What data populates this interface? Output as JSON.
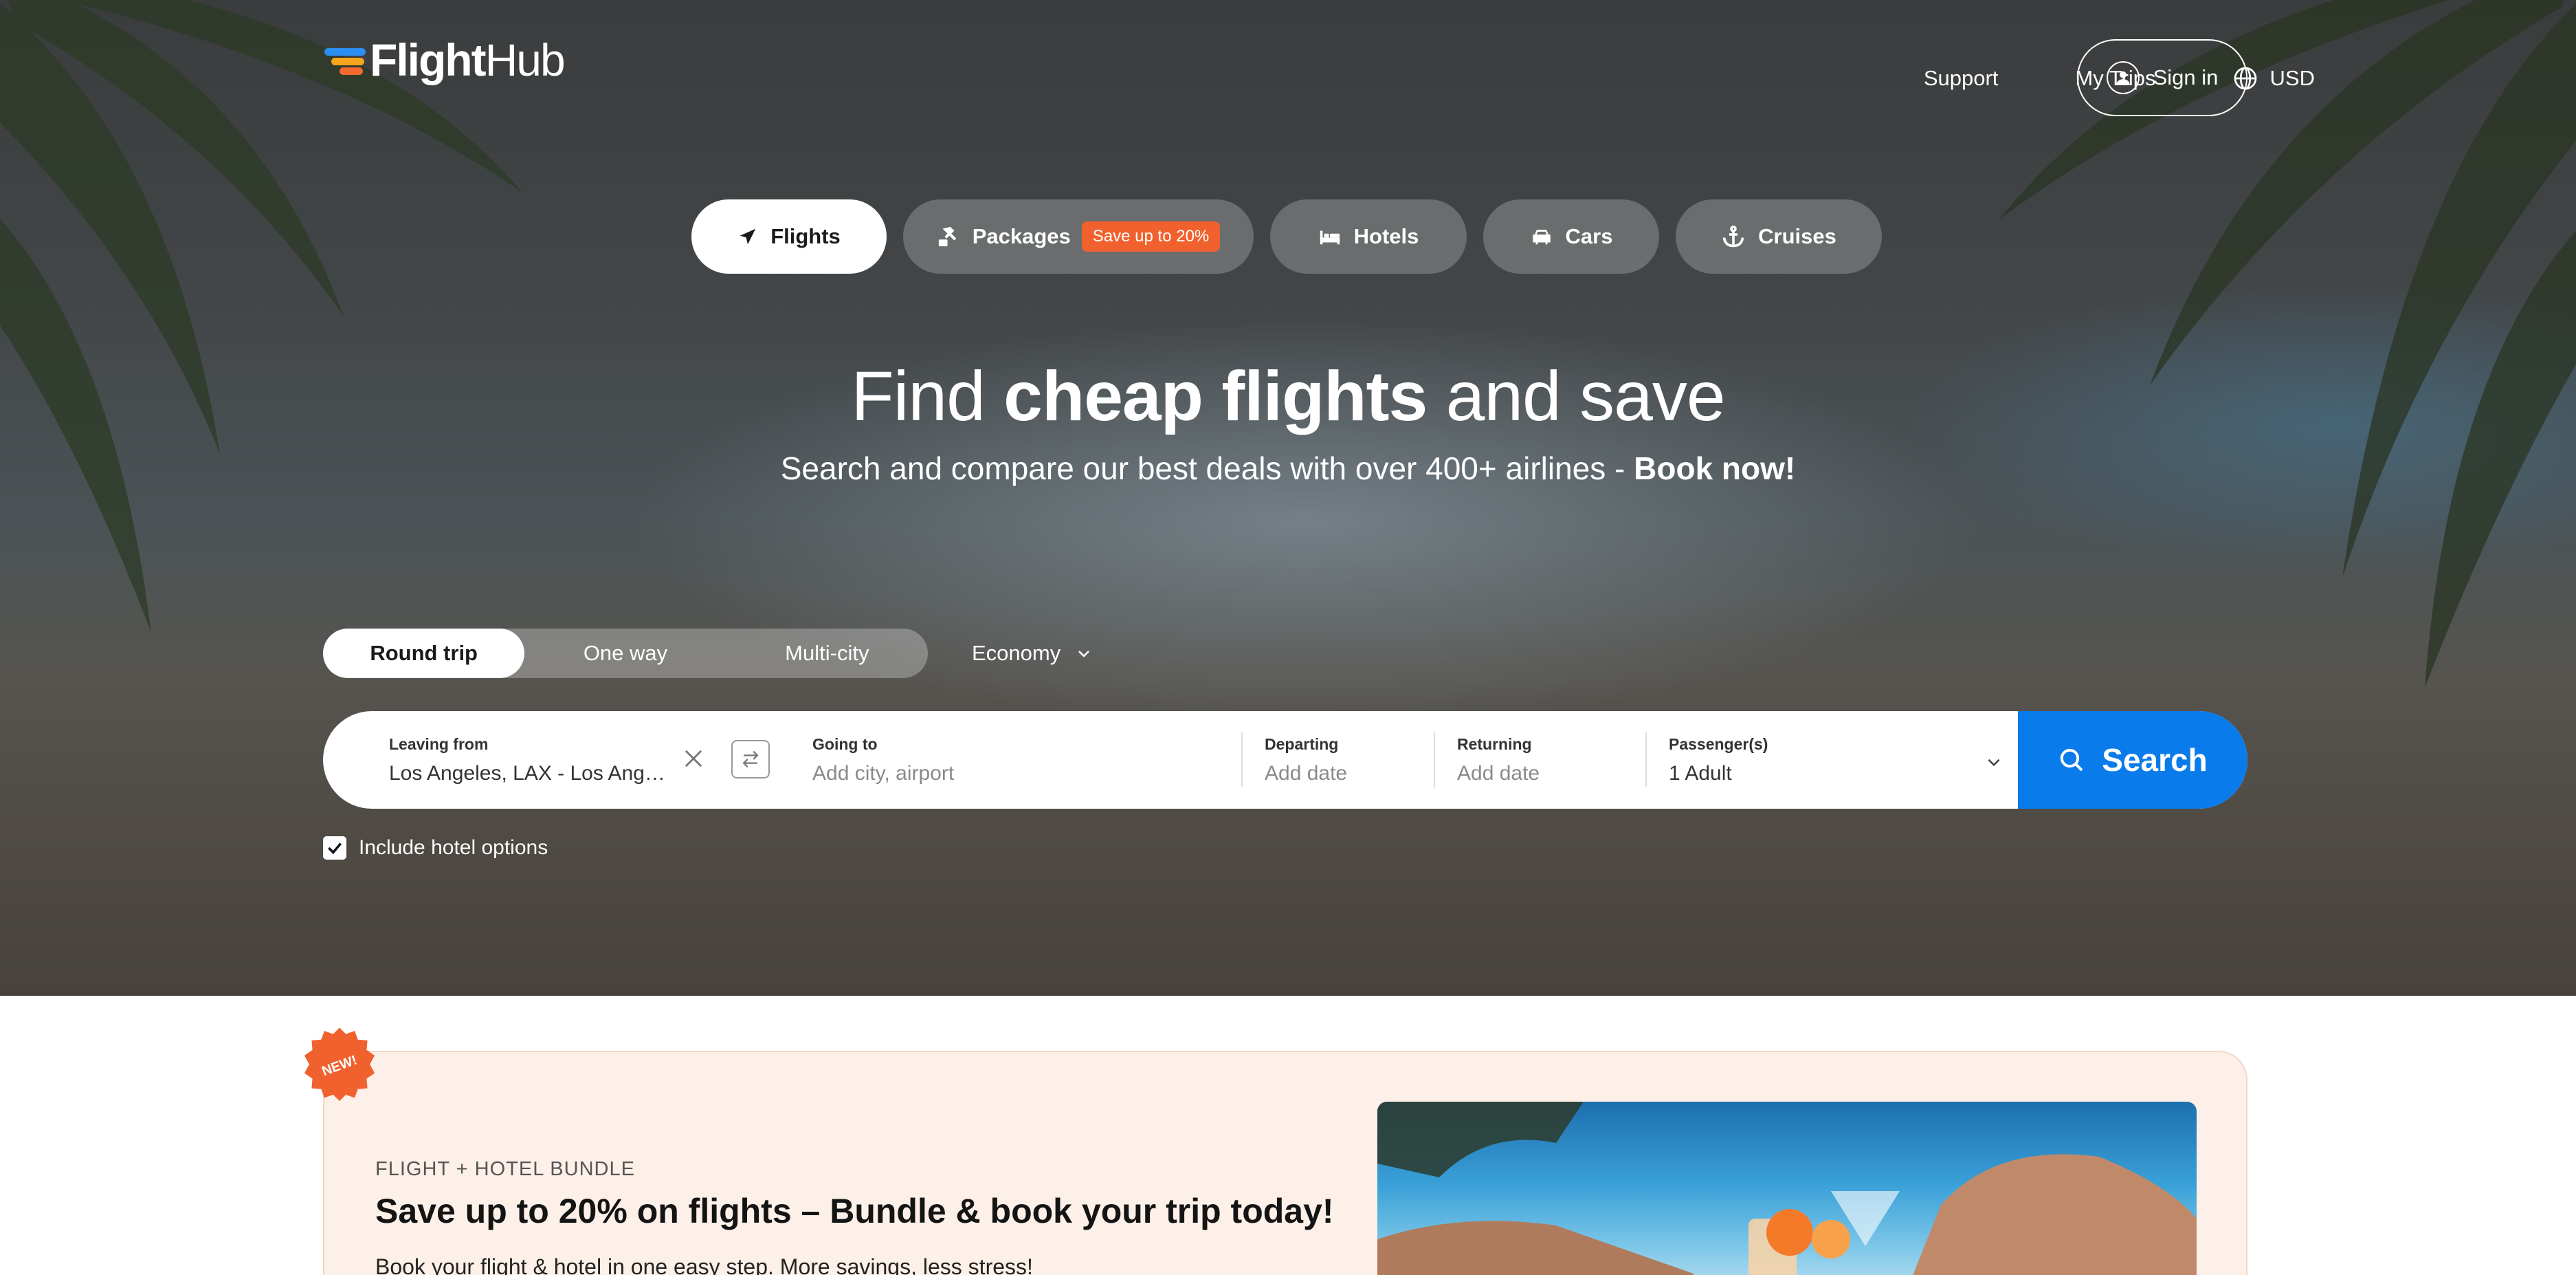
{
  "brand": {
    "name_bold": "Flight",
    "name_light": "Hub"
  },
  "topnav": {
    "support": "Support",
    "my_trips": "My Trips",
    "currency": "USD",
    "sign_in": "Sign in"
  },
  "product_tabs": [
    {
      "label": "Flights",
      "icon": "plane-icon",
      "active": true
    },
    {
      "label": "Packages",
      "icon": "package-icon",
      "badge": "Save up to 20%"
    },
    {
      "label": "Hotels",
      "icon": "bed-icon"
    },
    {
      "label": "Cars",
      "icon": "car-icon"
    },
    {
      "label": "Cruises",
      "icon": "anchor-icon"
    }
  ],
  "hero": {
    "headline_pre": "Find ",
    "headline_bold": "cheap flights",
    "headline_post": " and save",
    "sub_pre": "Search and compare our best deals with over 400+ airlines - ",
    "sub_bold": "Book now!"
  },
  "trip_types": [
    "Round trip",
    "One way",
    "Multi-city"
  ],
  "trip_type_selected": "Round trip",
  "cabin_class": "Economy",
  "search": {
    "from_label": "Leaving from",
    "from_value": "Los Angeles, LAX - Los Ang…",
    "to_label": "Going to",
    "to_placeholder": "Add city, airport",
    "departing_label": "Departing",
    "departing_placeholder": "Add date",
    "returning_label": "Returning",
    "returning_placeholder": "Add date",
    "passengers_label": "Passenger(s)",
    "passengers_value": "1 Adult",
    "button": "Search"
  },
  "include_hotel": {
    "label": "Include hotel options",
    "checked": true
  },
  "promo": {
    "badge": "NEW!",
    "eyebrow": "FLIGHT + HOTEL BUNDLE",
    "title": "Save up to 20% on flights – Bundle & book your trip today!",
    "description": "Book your flight & hotel in one easy step. More savings, less stress!"
  },
  "colors": {
    "primary": "#0a7bea",
    "accent": "#f0612e",
    "promo_bg": "#fdf0e8"
  }
}
